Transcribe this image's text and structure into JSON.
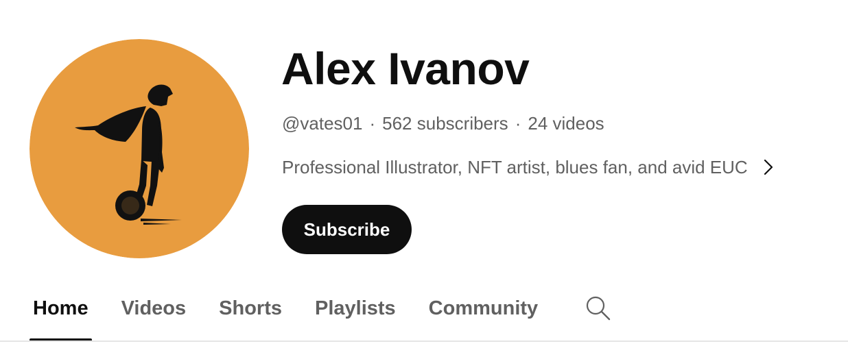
{
  "channel": {
    "name": "Alex Ivanov",
    "handle": "@vates01",
    "subscribers": "562 subscribers",
    "videos": "24 videos",
    "meta_separator": "·",
    "description": "Professional Illustrator, NFT artist, blues fan, and avid EUC",
    "avatar_color": "#E89C3F"
  },
  "subscribe_button": {
    "label": "Subscribe",
    "background": "#0F0F0F",
    "text_color": "#FFFFFF"
  },
  "tabs": [
    {
      "label": "Home",
      "active": true
    },
    {
      "label": "Videos",
      "active": false
    },
    {
      "label": "Shorts",
      "active": false
    },
    {
      "label": "Playlists",
      "active": false
    },
    {
      "label": "Community",
      "active": false
    }
  ],
  "icons": {
    "description_more": "chevron-right-icon",
    "tab_search": "search-icon"
  },
  "colors": {
    "primary_text": "#0F0F0F",
    "secondary_text": "#606060",
    "divider": "#E5E5E5"
  }
}
